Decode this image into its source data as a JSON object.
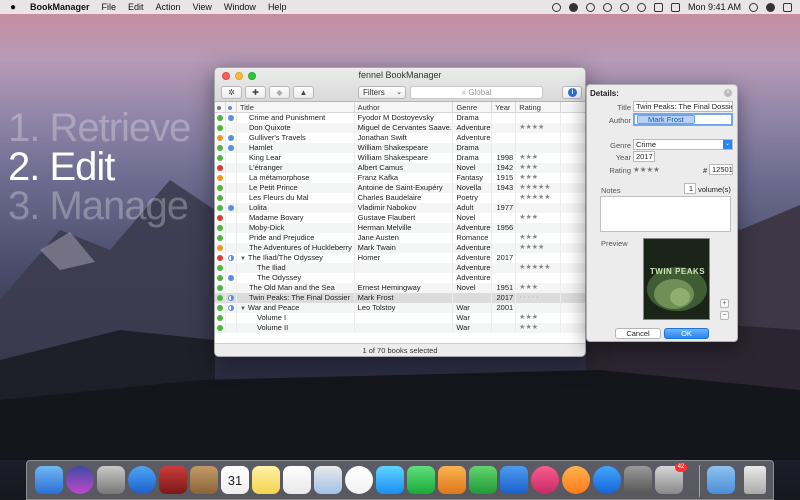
{
  "menubar": {
    "app_name": "BookManager",
    "items": [
      "File",
      "Edit",
      "Action",
      "View",
      "Window",
      "Help"
    ],
    "clock": "Mon 9:41 AM"
  },
  "desktop": {
    "taglines": [
      "1. Retrieve",
      "2. Edit",
      "3. Manage"
    ]
  },
  "window": {
    "title": "fennel BookManager",
    "filters_label": "Filters",
    "search_placeholder": "Global",
    "columns": [
      "Title",
      "Author",
      "Genre",
      "Year",
      "Rating"
    ],
    "rows": [
      {
        "status": "green",
        "flag": "blue",
        "title": "Crime and Punishment",
        "author": "Fyodor M Dostoyevsky",
        "genre": "Drama",
        "year": "",
        "rating": "",
        "indent": 0,
        "tri": ""
      },
      {
        "status": "green",
        "flag": "",
        "title": "Don Quixote",
        "author": "Miguel de Cervantes Saave...",
        "genre": "Adventure",
        "year": "",
        "rating": "★★★★",
        "indent": 0,
        "tri": ""
      },
      {
        "status": "orange",
        "flag": "blue",
        "title": "Gulliver's Travels",
        "author": "Jonathan Swift",
        "genre": "Adventure",
        "year": "",
        "rating": "",
        "indent": 0,
        "tri": ""
      },
      {
        "status": "green",
        "flag": "blue",
        "title": "Hamlet",
        "author": "William Shakespeare",
        "genre": "Drama",
        "year": "",
        "rating": "",
        "indent": 0,
        "tri": ""
      },
      {
        "status": "green",
        "flag": "",
        "title": "King Lear",
        "author": "William Shakespeare",
        "genre": "Drama",
        "year": "1998",
        "rating": "★★★",
        "indent": 0,
        "tri": ""
      },
      {
        "status": "red",
        "flag": "",
        "title": "L'étranger",
        "author": "Albert Camus",
        "genre": "Novel",
        "year": "1942",
        "rating": "★★★",
        "indent": 0,
        "tri": ""
      },
      {
        "status": "orange",
        "flag": "",
        "title": "La métamorphose",
        "author": "Franz Kafka",
        "genre": "Fantasy",
        "year": "1915",
        "rating": "★★★",
        "indent": 0,
        "tri": ""
      },
      {
        "status": "green",
        "flag": "",
        "title": "Le Petit Prince",
        "author": "Antoine de Saint-Exupéry",
        "genre": "Novella",
        "year": "1943",
        "rating": "★★★★★",
        "indent": 0,
        "tri": ""
      },
      {
        "status": "green",
        "flag": "",
        "title": "Les Fleurs du Mal",
        "author": "Charles Baudelaire",
        "genre": "Poetry",
        "year": "",
        "rating": "★★★★★",
        "indent": 0,
        "tri": ""
      },
      {
        "status": "green",
        "flag": "blue",
        "title": "Lolita",
        "author": "Vladimir Nabokov",
        "genre": "Adult",
        "year": "1977",
        "rating": "",
        "indent": 0,
        "tri": ""
      },
      {
        "status": "red",
        "flag": "",
        "title": "Madame Bovary",
        "author": "Gustave Flaubert",
        "genre": "Novel",
        "year": "",
        "rating": "★★★",
        "indent": 0,
        "tri": ""
      },
      {
        "status": "green",
        "flag": "",
        "title": "Moby-Dick",
        "author": "Herman Melville",
        "genre": "Adventure",
        "year": "1956",
        "rating": "",
        "indent": 0,
        "tri": ""
      },
      {
        "status": "green",
        "flag": "",
        "title": "Pride and Prejudice",
        "author": "Jane Austen",
        "genre": "Romance",
        "year": "",
        "rating": "★★★",
        "indent": 0,
        "tri": ""
      },
      {
        "status": "orange",
        "flag": "",
        "title": "The Adventures of Huckleberry Finn",
        "author": "Mark Twain",
        "genre": "Adventure",
        "year": "",
        "rating": "★★★★",
        "indent": 0,
        "tri": ""
      },
      {
        "status": "red",
        "flag": "half",
        "title": "The Iliad/The Odyssey",
        "author": "Homer",
        "genre": "Adventure",
        "year": "2017",
        "rating": "",
        "indent": 0,
        "tri": "▼"
      },
      {
        "status": "green",
        "flag": "",
        "title": "The Iliad",
        "author": "",
        "genre": "Adventure",
        "year": "",
        "rating": "★★★★★",
        "indent": 1,
        "tri": ""
      },
      {
        "status": "green",
        "flag": "blue",
        "title": "The Odyssey",
        "author": "",
        "genre": "Adventure",
        "year": "",
        "rating": "",
        "indent": 1,
        "tri": ""
      },
      {
        "status": "green",
        "flag": "",
        "title": "The Old Man and the Sea",
        "author": "Ernest Hemingway",
        "genre": "Novel",
        "year": "1951",
        "rating": "★★★",
        "indent": 0,
        "tri": ""
      },
      {
        "status": "green",
        "flag": "half",
        "title": "Twin Peaks: The Final Dossier",
        "author": "Mark Frost",
        "genre": "",
        "year": "2017",
        "rating": "· · · · ·",
        "indent": 0,
        "tri": "",
        "selected": true
      },
      {
        "status": "green",
        "flag": "half",
        "title": "War and Peace",
        "author": "Leo Tolstoy",
        "genre": "War",
        "year": "2001",
        "rating": "",
        "indent": 0,
        "tri": "▼"
      },
      {
        "status": "green",
        "flag": "",
        "title": "Volume I",
        "author": "",
        "genre": "War",
        "year": "",
        "rating": "★★★",
        "indent": 1,
        "tri": ""
      },
      {
        "status": "green",
        "flag": "",
        "title": "Volume II",
        "author": "",
        "genre": "War",
        "year": "",
        "rating": "★★★",
        "indent": 1,
        "tri": ""
      }
    ],
    "status_text": "1 of 70 books selected"
  },
  "details": {
    "heading": "Details:",
    "title_label": "Title",
    "title_value": "Twin Peaks: The Final Dossie",
    "author_label": "Author",
    "author_value": "Mark Frost",
    "genre_label": "Genre",
    "genre_value": "Crime",
    "year_label": "Year",
    "year_value": "2017",
    "rating_label": "Rating",
    "rating_value": "★★★★",
    "number_prefix": "#",
    "number_value": "12501",
    "notes_label": "Notes",
    "volumes_count": "1",
    "volumes_label": "volume(s)",
    "preview_label": "Preview",
    "preview_cover_title": "TWIN PEAKS",
    "cancel_label": "Cancel",
    "ok_label": "OK"
  },
  "colors": {
    "green": "#4fb33c",
    "orange": "#f0951e",
    "red": "#d93a2f",
    "blue": "#5b8de6",
    "accent": "#2a84f2"
  },
  "dock": {
    "icons": [
      "finder-icon",
      "siri-icon",
      "launchpad-icon",
      "safari-icon",
      "photo-booth-icon",
      "contacts-icon",
      "calendar-icon",
      "notes-icon",
      "reminders-icon",
      "preview-icon",
      "photos-icon",
      "messages-icon",
      "facetime-icon",
      "pages-icon",
      "numbers-icon",
      "keynote-icon",
      "itunes-icon",
      "ibooks-icon",
      "app-store-icon",
      "system-preferences-icon",
      "bookmanager-icon"
    ],
    "calendar_day": "31",
    "badge_count": "42"
  }
}
